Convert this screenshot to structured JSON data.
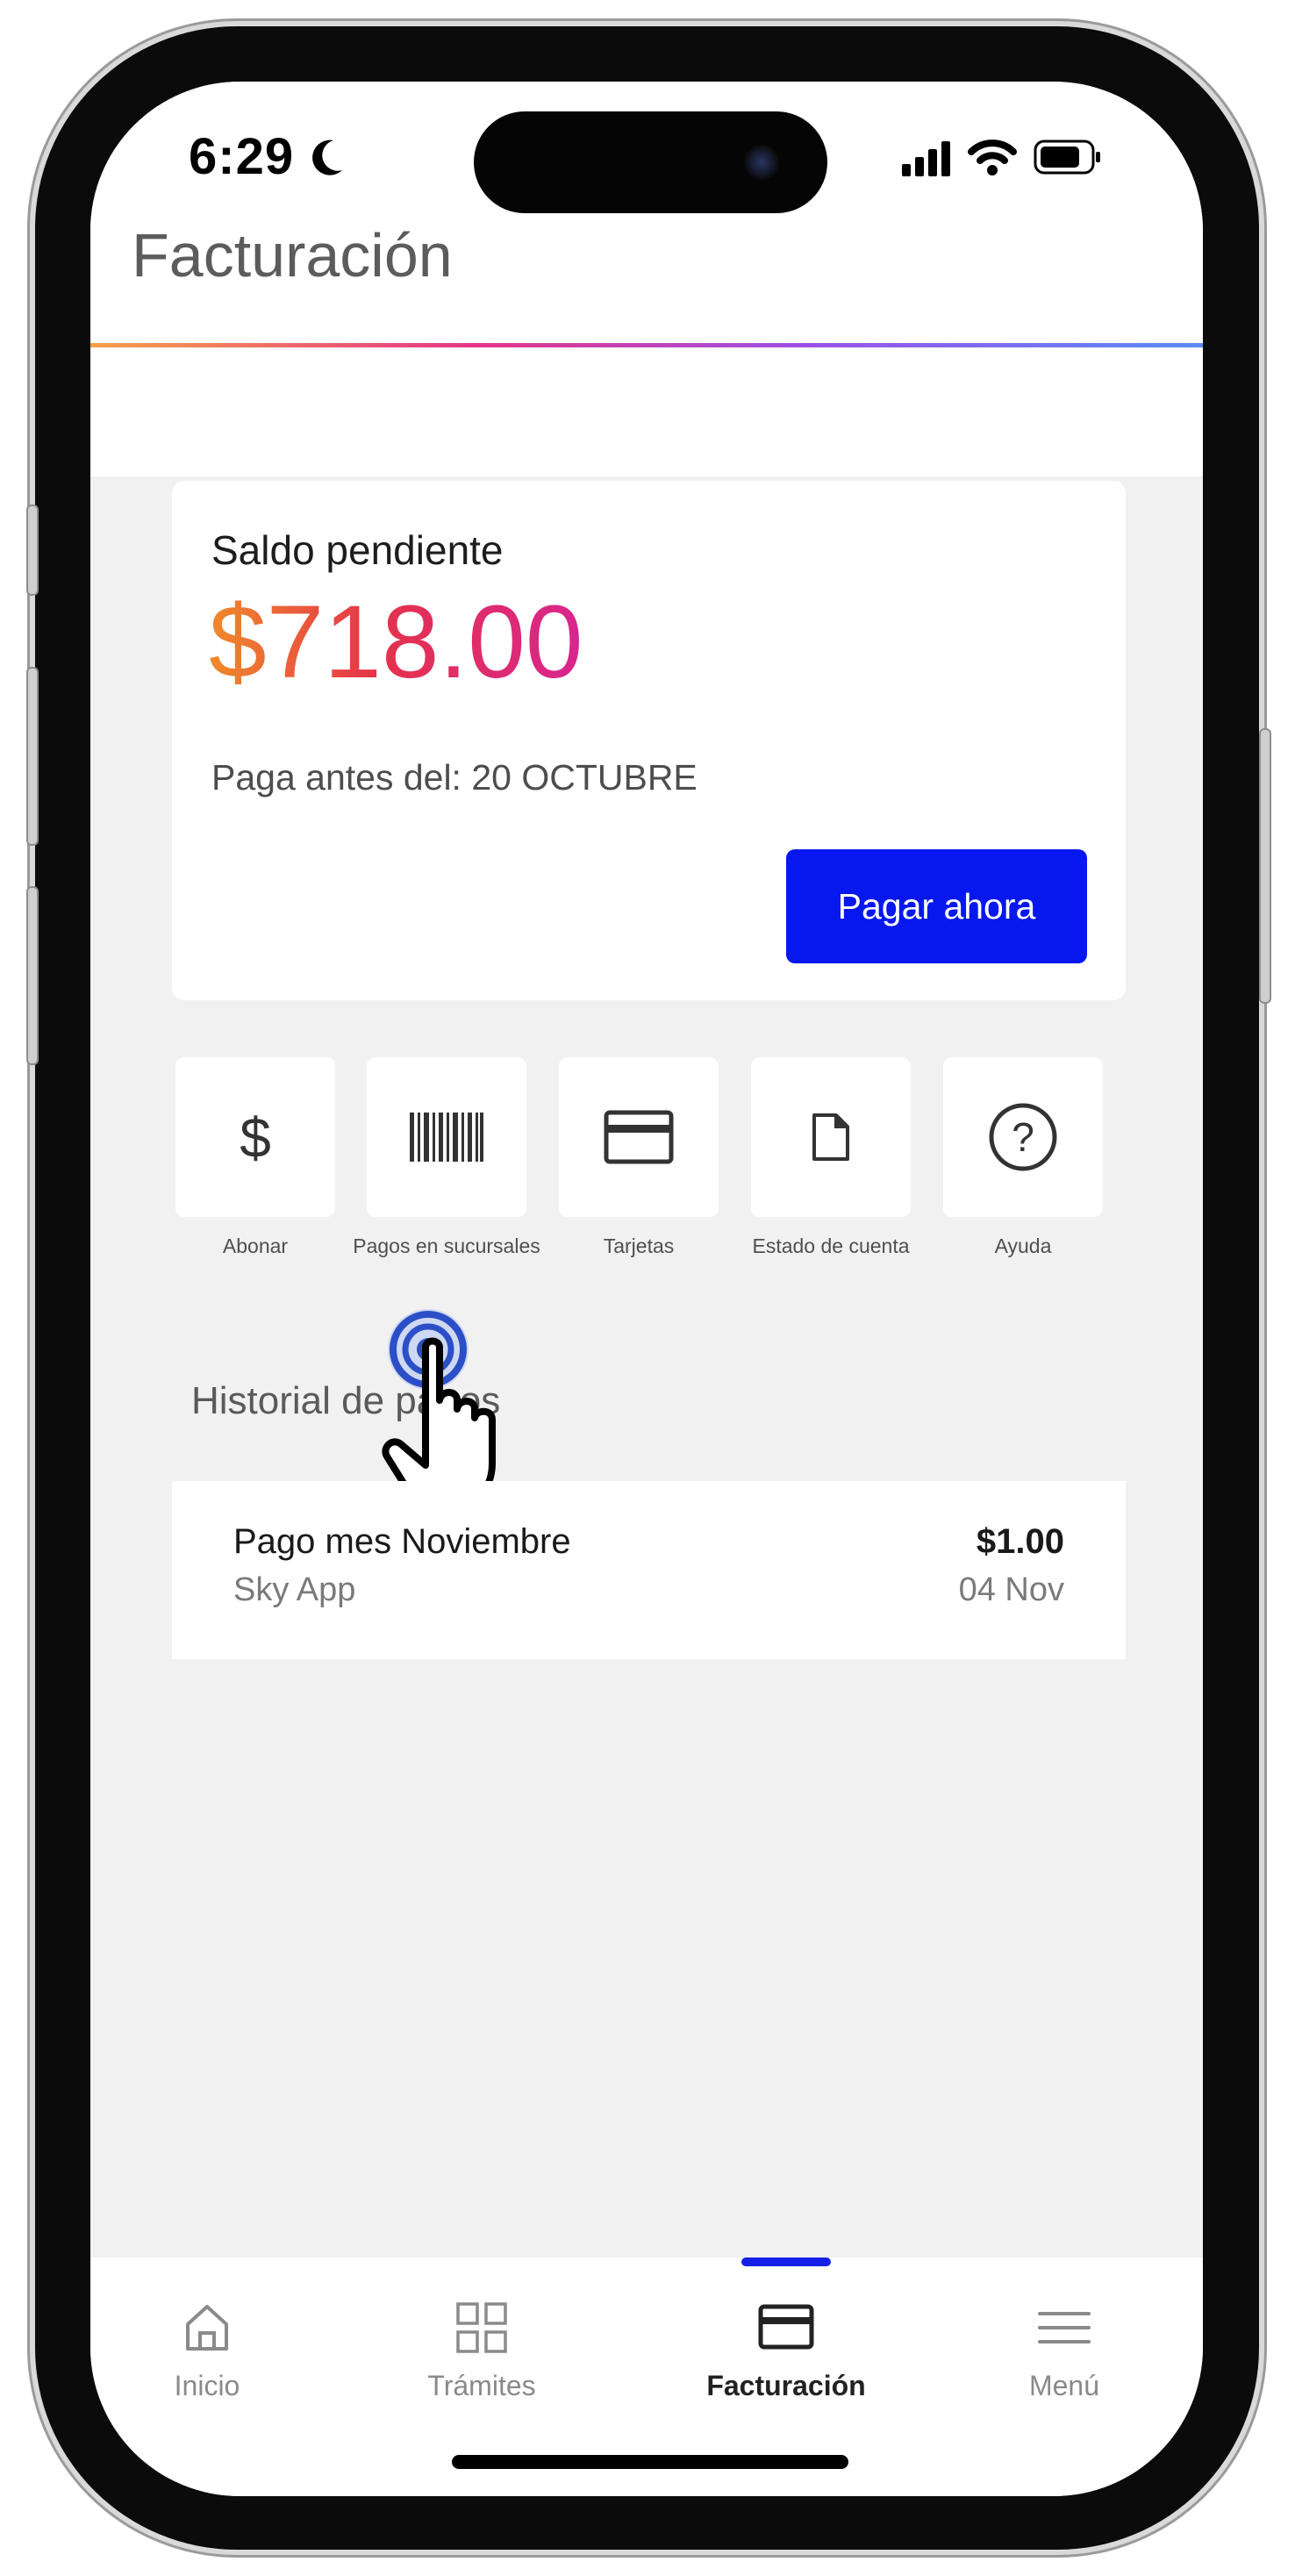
{
  "status_bar": {
    "time": "6:29"
  },
  "header": {
    "title": "Facturación"
  },
  "balance": {
    "label": "Saldo pendiente",
    "amount": "$718.00",
    "due_text": "Paga antes del: 20 OCTUBRE",
    "pay_button": "Pagar ahora"
  },
  "actions": [
    {
      "label": "Abonar",
      "icon": "dollar-icon"
    },
    {
      "label": "Pagos en sucursales",
      "icon": "barcode-icon"
    },
    {
      "label": "Tarjetas",
      "icon": "card-icon"
    },
    {
      "label": "Estado de cuenta",
      "icon": "document-icon"
    },
    {
      "label": "Ayuda",
      "icon": "help-icon"
    }
  ],
  "history": {
    "title": "Historial de pagos",
    "items": [
      {
        "name": "Pago mes Noviembre",
        "source": "Sky App",
        "amount": "$1.00",
        "date": "04 Nov"
      }
    ]
  },
  "bottom_nav": [
    {
      "label": "Inicio",
      "icon": "home-icon"
    },
    {
      "label": "Trámites",
      "icon": "grid-icon"
    },
    {
      "label": "Facturación",
      "icon": "card-icon",
      "active": true
    },
    {
      "label": "Menú",
      "icon": "menu-icon"
    }
  ],
  "colors": {
    "primary_button": "#0718ef",
    "amount_gradient": [
      "#f08a2a",
      "#e5324a",
      "#d8258f"
    ],
    "active_indicator": "#1521e8",
    "background": "#f1f1f1"
  }
}
